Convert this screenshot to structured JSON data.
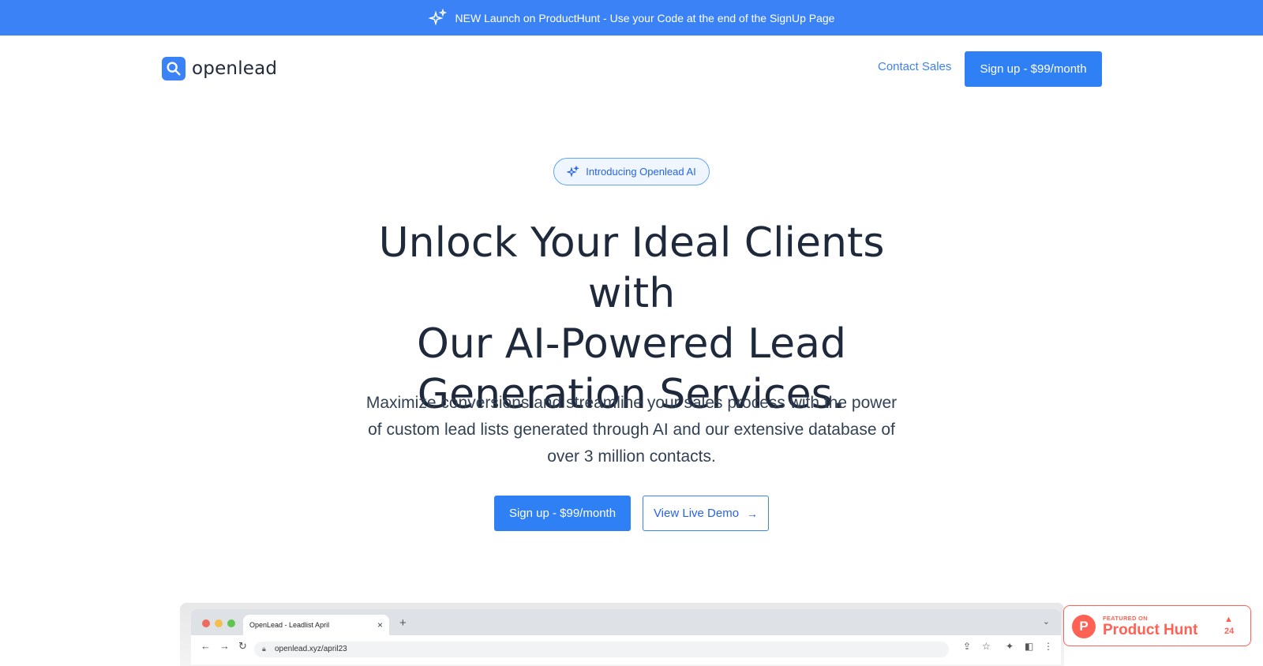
{
  "banner": {
    "icon": "sparkle-icon",
    "text": "NEW Launch on ProductHunt - Use your Code at the end of the SignUp Page"
  },
  "header": {
    "logo_icon": "search-icon",
    "brand": "openlead",
    "contact_label": "Contact Sales",
    "signup_label": "Sign up - $99/month"
  },
  "pill": {
    "icon": "sparkle-icon",
    "text": "Introducing Openlead AI"
  },
  "hero": {
    "title_line1": "Unlock Your Ideal Clients with",
    "title_line2": "Our AI-Powered Lead",
    "title_line3": "Generation Services.",
    "subtitle_line1": "Maximize conversions and streamline your sales process with the power",
    "subtitle_line2": "of custom lead lists generated through AI and our extensive database of",
    "subtitle_line3": "over 3 million contacts.",
    "primary_cta": "Sign up - $99/month",
    "secondary_cta": "View Live Demo",
    "secondary_icon": "→"
  },
  "browser": {
    "tab_title": "OpenLead - Leadlist April",
    "tab_close": "×",
    "new_tab": "+",
    "url": "openlead.xyz/april23"
  },
  "product_hunt": {
    "small_text": "FEATURED ON",
    "name": "Product Hunt",
    "logo_letter": "P",
    "upvote_symbol": "▲",
    "count": "24"
  },
  "colors": {
    "accent": "#3b82f6",
    "product_hunt": "#ff6154"
  }
}
